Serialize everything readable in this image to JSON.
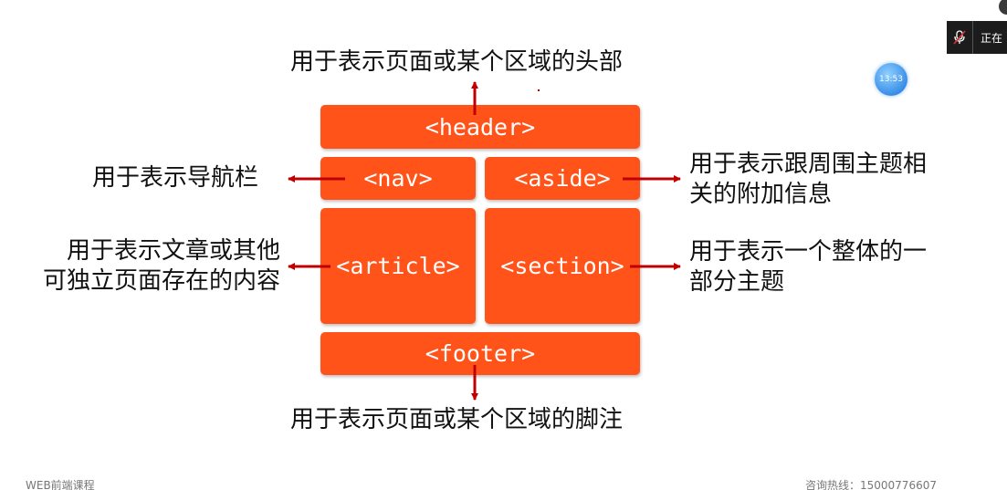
{
  "diagram": {
    "boxes": {
      "header": "<header>",
      "nav": "<nav>",
      "aside": "<aside>",
      "article": "<article>",
      "section": "<section>",
      "footer": "<footer>"
    },
    "labels": {
      "header": "用于表示页面或某个区域的头部",
      "nav": "用于表示导航栏",
      "aside_line1": "用于表示跟周围主题相",
      "aside_line2": "关的附加信息",
      "article_line1": "用于表示文章或其他",
      "article_line2": "可独立页面存在的内容",
      "section_line1": "用于表示一个整体的一",
      "section_line2": "部分主题",
      "footer": "用于表示页面或某个区域的脚注"
    },
    "colors": {
      "box": "#ff5319",
      "arrow": "#c00000"
    }
  },
  "overlay": {
    "recording_status": "正在",
    "mic_icon": "mic-muted-icon",
    "clock_time": "13:53",
    "footer_left": "WEB前端课程",
    "footer_right": "咨询热线：15000776607"
  }
}
